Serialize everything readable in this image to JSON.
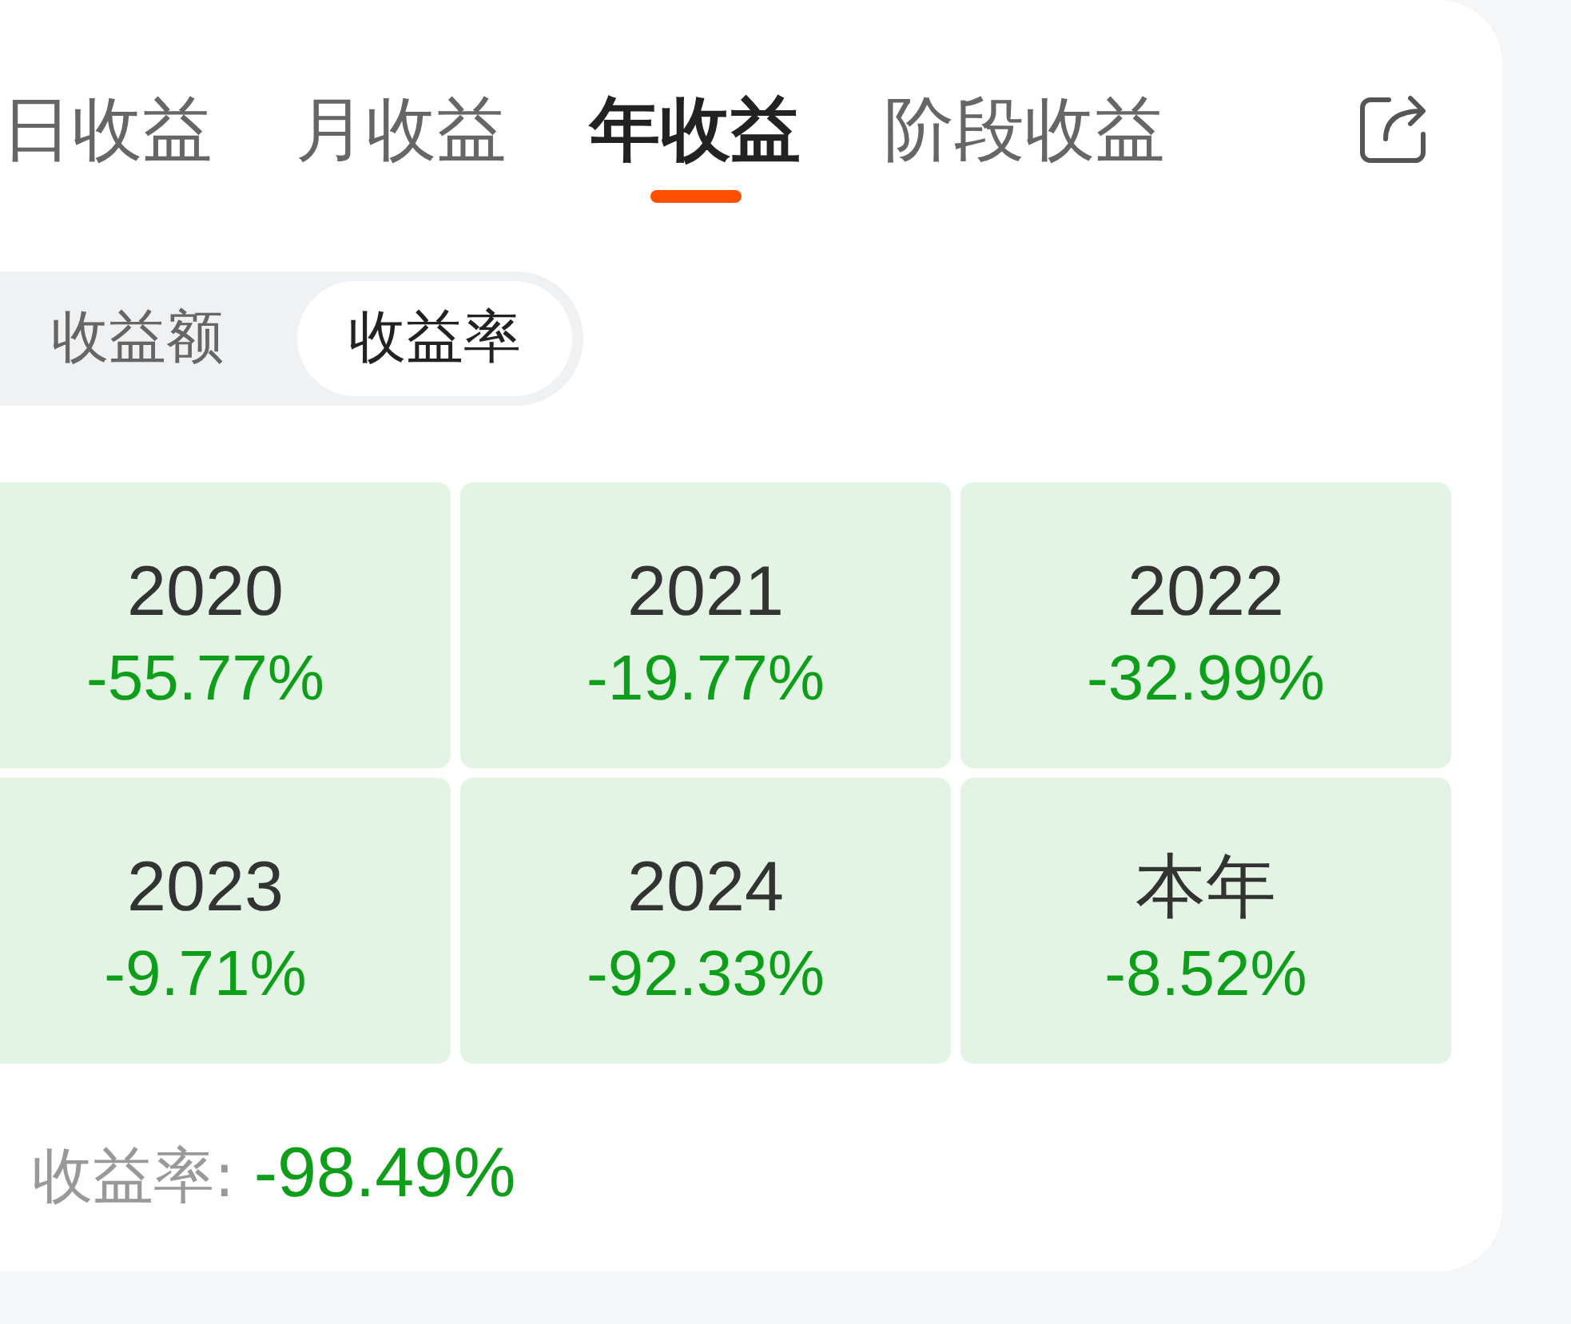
{
  "tabs": [
    {
      "label": "日收益",
      "selected": false
    },
    {
      "label": "月收益",
      "selected": false
    },
    {
      "label": "年收益",
      "selected": true
    },
    {
      "label": "阶段收益",
      "selected": false
    }
  ],
  "segments": [
    {
      "label": "收益额",
      "selected": false
    },
    {
      "label": "收益率",
      "selected": true
    }
  ],
  "periods": [
    {
      "period": "2020",
      "value": "-55.77%"
    },
    {
      "period": "2021",
      "value": "-19.77%"
    },
    {
      "period": "2022",
      "value": "-32.99%"
    },
    {
      "period": "2023",
      "value": "-9.71%"
    },
    {
      "period": "2024",
      "value": "-92.33%"
    },
    {
      "period": "本年",
      "value": "-8.52%"
    }
  ],
  "total": {
    "label": "收益率:",
    "value": "-98.49%"
  }
}
